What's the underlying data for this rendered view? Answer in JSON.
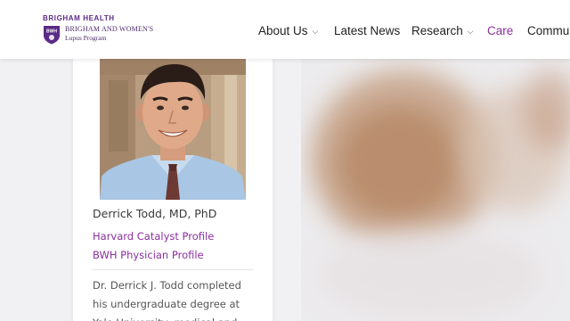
{
  "header": {
    "org_label": "BRIGHAM HEALTH",
    "logo_line1": "BRIGHAM AND WOMEN'S",
    "logo_line2": "Lupus Program",
    "logo_shield_text": "BWH"
  },
  "nav": {
    "items": [
      {
        "label": "About Us",
        "has_dropdown": true
      },
      {
        "label": "Latest News",
        "has_dropdown": false
      },
      {
        "label": "Research",
        "has_dropdown": true
      },
      {
        "label": "Care",
        "has_dropdown": false,
        "active": true
      },
      {
        "label": "Commun",
        "has_dropdown": false
      }
    ],
    "dropdown_icon": "chevron-down-icon"
  },
  "profile": {
    "name": "Derrick Todd, MD, PhD",
    "links": {
      "harvard": "Harvard Catalyst Profile",
      "bwh": "BWH Physician Profile"
    },
    "bio_lines": [
      "Dr. Derrick J. Todd completed",
      "his undergraduate degree at",
      "Yale University, medical and"
    ]
  },
  "colors": {
    "brand_purple": "#5b2a86",
    "link_purple": "#8b2f9e",
    "active_nav": "#8b2f9e"
  }
}
